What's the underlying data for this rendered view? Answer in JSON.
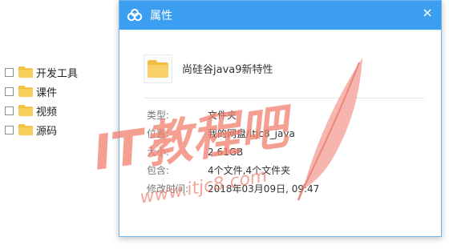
{
  "tree": {
    "items": [
      {
        "label": "开发工具"
      },
      {
        "label": "课件"
      },
      {
        "label": "视频"
      },
      {
        "label": "源码"
      }
    ]
  },
  "dialog": {
    "title": "属性",
    "file_name": "尚硅谷java9新特性",
    "props": [
      {
        "label": "类型:",
        "value": "文件夹"
      },
      {
        "label": "位置:",
        "value": "我的网盘/itjc8_java"
      },
      {
        "label": "大小:",
        "value": "2.61GB"
      },
      {
        "label": "包含:",
        "value": "4个文件,4个文件夹"
      },
      {
        "label": "修改时间:",
        "value": "2018年03月09日, 09:47"
      }
    ]
  },
  "watermark": {
    "text_main": "IT教程吧",
    "text_url": "www.itjc8.com"
  },
  "colors": {
    "titlebar": "#3b9ef0",
    "folder": "#f5c242",
    "watermark": "#f07f6e"
  },
  "icons": {
    "title": "cloud-icon",
    "close": "close-icon",
    "folder": "folder-icon"
  }
}
